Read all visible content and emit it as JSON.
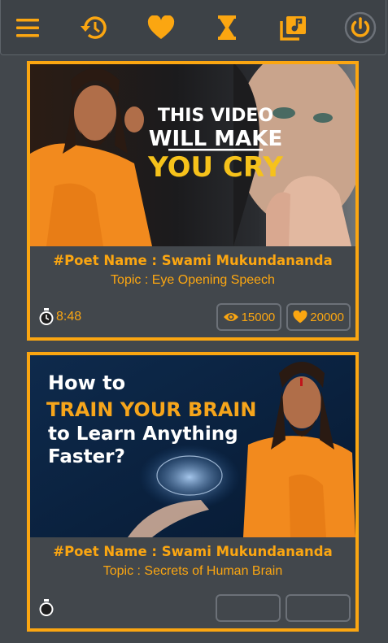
{
  "colors": {
    "accent": "#fba611",
    "background": "#42474c",
    "topbar": "#3d4247"
  },
  "topbar": {
    "icons": [
      "menu-icon",
      "history-icon",
      "heart-icon",
      "hourglass-icon",
      "music-library-icon",
      "power-icon"
    ]
  },
  "videos": [
    {
      "thumbnail_lines": [
        "THIS VIDEO",
        "WILL MAKE",
        "YOU CRY"
      ],
      "poet": "#Poet Name : Swami Mukundananda",
      "topic": "Topic : Eye Opening Speech",
      "duration": "8:48",
      "views": "15000",
      "likes": "20000"
    },
    {
      "thumbnail_lines": [
        "How to",
        "TRAIN YOUR BRAIN",
        "to Learn Anything",
        "Faster?"
      ],
      "poet": "#Poet Name : Swami Mukundananda",
      "topic": "Topic : Secrets of Human Brain",
      "duration": "",
      "views": "",
      "likes": ""
    }
  ]
}
